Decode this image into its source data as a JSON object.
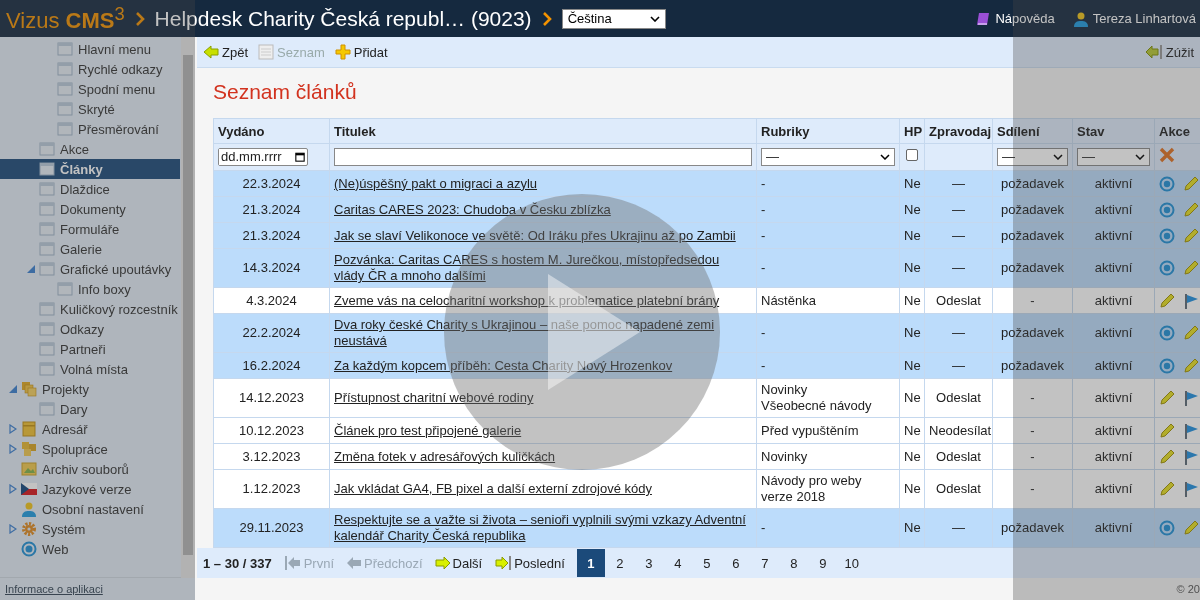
{
  "header": {
    "logo": "Vizus **CMS**$^{3}$",
    "title": "Helpdesk Charity Česká republ… (9023)",
    "language": "Čeština",
    "help": "Nápověda",
    "user": "Tereza Linhartová"
  },
  "sidebar": {
    "items": [
      {
        "children": [
          {
            "children": [
              {
                "label": "Hlavní menu",
                "kind": "page",
                "selected": false
              },
              {
                "label": "Rychlé odkazy",
                "kind": "page",
                "selected": false
              },
              {
                "label": "Spodní menu",
                "kind": "page",
                "selected": false
              },
              {
                "label": "Skryté",
                "kind": "page",
                "selected": false
              },
              {
                "label": "Přesměrování",
                "kind": "page",
                "selected": false
              }
            ]
          },
          {
            "label": "Akce",
            "kind": "page",
            "selected": false
          },
          {
            "label": "Články",
            "kind": "page",
            "selected": true
          },
          {
            "label": "Dlaždice",
            "kind": "page",
            "selected": false
          },
          {
            "label": "Dokumenty",
            "kind": "page",
            "selected": false
          },
          {
            "label": "Formuláře",
            "kind": "page",
            "selected": false
          },
          {
            "label": "Galerie",
            "kind": "page",
            "selected": false
          },
          {
            "label": "Grafické upoutávky",
            "kind": "page",
            "selected": false,
            "expanded": true,
            "children": [
              {
                "label": "Info boxy",
                "kind": "page",
                "selected": false
              }
            ]
          },
          {
            "label": "Kuličkový rozcestník",
            "kind": "page",
            "selected": false
          },
          {
            "label": "Odkazy",
            "kind": "page",
            "selected": false
          },
          {
            "label": "Partneři",
            "kind": "page",
            "selected": false
          },
          {
            "label": "Volná místa",
            "kind": "page",
            "selected": false
          }
        ]
      },
      {
        "label": "Projekty",
        "kind": "folder",
        "selected": false,
        "expanded": true,
        "children": [
          {
            "label": "Dary",
            "kind": "page",
            "selected": false
          }
        ]
      },
      {
        "label": "Adresář",
        "kind": "addressbook",
        "selected": false,
        "expanded": false
      },
      {
        "label": "Spolupráce",
        "kind": "cooperation",
        "selected": false,
        "expanded": false
      },
      {
        "label": "Archiv souborů",
        "kind": "archive",
        "selected": false
      },
      {
        "label": "Jazykové verze",
        "kind": "language",
        "selected": false,
        "expanded": false
      },
      {
        "label": "Osobní nastavení",
        "kind": "user",
        "selected": false
      },
      {
        "label": "Systém",
        "kind": "settings",
        "selected": false,
        "expanded": false
      },
      {
        "label": "Web",
        "kind": "web",
        "selected": false
      }
    ],
    "footer_link": "Informace o aplikaci"
  },
  "toolbar": {
    "buttons": [
      {
        "label": "Zpět",
        "kind": "back",
        "disabled": false
      },
      {
        "label": "Seznam",
        "kind": "list",
        "disabled": true
      },
      {
        "label": "Přidat",
        "kind": "add",
        "disabled": false
      }
    ],
    "collapse": "Zúžit"
  },
  "heading": "Seznam článků",
  "table": {
    "columns": [
      "Vydáno",
      "Titulek",
      "Rubriky",
      "HP",
      "Zpravodaj",
      "Sdílení",
      "Stav",
      "Akce"
    ],
    "filters": {
      "date_placeholder": "dd.mm.rrrr",
      "rubriky": "—",
      "hp_checked": false,
      "sdileni": "—",
      "stav": "—"
    },
    "rows": [
      {
        "kind": "shared",
        "date": "22.3.2024",
        "title": "(Ne)úspěšný pakt o migraci a azylu",
        "rubriky": [
          "-"
        ],
        "hp": "Ne",
        "zpravodaj": "—",
        "sdileni": "požadavek",
        "stav": "aktivní"
      },
      {
        "kind": "shared",
        "date": "21.3.2024",
        "title": "Caritas CARES 2023: Chudoba v Česku zblízka",
        "rubriky": [
          "-"
        ],
        "hp": "Ne",
        "zpravodaj": "—",
        "sdileni": "požadavek",
        "stav": "aktivní"
      },
      {
        "kind": "shared",
        "date": "21.3.2024",
        "title": "Jak se slaví Velikonoce ve světě: Od Iráku přes Ukrajinu až po Zambii",
        "rubriky": [
          "-"
        ],
        "hp": "Ne",
        "zpravodaj": "—",
        "sdileni": "požadavek",
        "stav": "aktivní"
      },
      {
        "kind": "shared",
        "date": "14.3.2024",
        "title": "Pozvánka: Caritas CARES s hostem M. Jurečkou, místopředsedou vlády ČR a mnoho dalšími",
        "rubriky": [
          "-"
        ],
        "hp": "Ne",
        "zpravodaj": "—",
        "sdileni": "požadavek",
        "stav": "aktivní"
      },
      {
        "kind": "newsletter",
        "date": "4.3.2024",
        "title": "Zveme vás na celocharitní workshop k problematice platební brány",
        "rubriky": [
          "Nástěnka"
        ],
        "hp": "Ne",
        "zpravodaj": "Odeslat",
        "sdileni": "-",
        "stav": "aktivní"
      },
      {
        "kind": "shared",
        "date": "22.2.2024",
        "title": "Dva roky české Charity s Ukrajinou – naše pomoc napadené zemi neustává",
        "rubriky": [
          "-"
        ],
        "hp": "Ne",
        "zpravodaj": "—",
        "sdileni": "požadavek",
        "stav": "aktivní"
      },
      {
        "kind": "shared",
        "date": "16.2.2024",
        "title": "Za každým kopcem příběh: Cesta Charity Nový Hrozenkov",
        "rubriky": [
          "-"
        ],
        "hp": "Ne",
        "zpravodaj": "—",
        "sdileni": "požadavek",
        "stav": "aktivní"
      },
      {
        "kind": "newsletter",
        "date": "14.12.2023",
        "title": "Přístupnost charitní webové rodiny",
        "rubriky": [
          "Novinky",
          "Všeobecné návody"
        ],
        "hp": "Ne",
        "zpravodaj": "Odeslat",
        "sdileni": "-",
        "stav": "aktivní"
      },
      {
        "kind": "newsletter",
        "date": "10.12.2023",
        "title": "Článek pro test připojené galerie",
        "rubriky": [
          "Před vypuštěním"
        ],
        "hp": "Ne",
        "zpravodaj": "Neodesílat",
        "sdileni": "-",
        "stav": "aktivní"
      },
      {
        "kind": "newsletter",
        "date": "3.12.2023",
        "title": "Změna fotek v adresářových kuličkách",
        "rubriky": [
          "Novinky"
        ],
        "hp": "Ne",
        "zpravodaj": "Odeslat",
        "sdileni": "-",
        "stav": "aktivní"
      },
      {
        "kind": "newsletter",
        "date": "1.12.2023",
        "title": "Jak vkládat GA4, FB pixel a další externí zdrojové kódy",
        "rubriky": [
          "Návody pro weby verze 2018"
        ],
        "hp": "Ne",
        "zpravodaj": "Odeslat",
        "sdileni": "-",
        "stav": "aktivní"
      },
      {
        "kind": "shared",
        "date": "29.11.2023",
        "title": "Respektujte se a važte si života – senioři vyplnili svými vzkazy Adventní kalendář Charity Česká republika",
        "rubriky": [
          "-"
        ],
        "hp": "Ne",
        "zpravodaj": "—",
        "sdileni": "požadavek",
        "stav": "aktivní"
      }
    ]
  },
  "pagination": {
    "range": "1 – 30 / 337",
    "nav": [
      {
        "label": "První",
        "kind": "first",
        "disabled": true
      },
      {
        "label": "Předchozí",
        "kind": "prev",
        "disabled": true
      },
      {
        "label": "Další",
        "kind": "next",
        "disabled": false
      },
      {
        "label": "Poslední",
        "kind": "last",
        "disabled": false
      }
    ],
    "pages": [
      {
        "label": "1",
        "selected": true
      },
      {
        "label": "2",
        "selected": false
      },
      {
        "label": "3",
        "selected": false
      },
      {
        "label": "4",
        "selected": false
      },
      {
        "label": "5",
        "selected": false
      },
      {
        "label": "6",
        "selected": false
      },
      {
        "label": "7",
        "selected": false
      },
      {
        "label": "8",
        "selected": false
      },
      {
        "label": "9",
        "selected": false
      },
      {
        "label": "10",
        "selected": false
      }
    ]
  },
  "copyright": "© 20"
}
